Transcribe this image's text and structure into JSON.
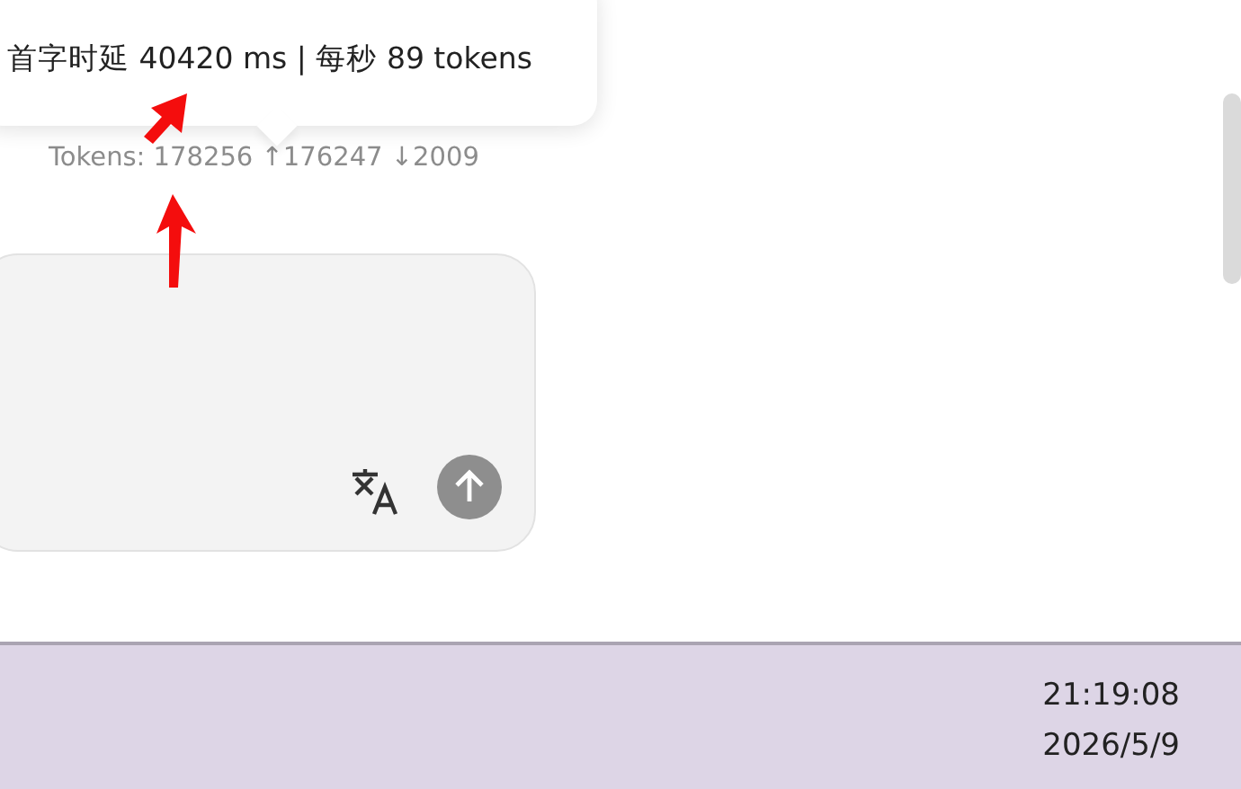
{
  "tooltip": {
    "text": "首字时延 40420 ms | 每秒 89 tokens"
  },
  "token_stats": {
    "text": "Tokens: 178256 ↑176247 ↓2009"
  },
  "composer": {
    "buttons": [
      {
        "kind": "translate"
      },
      {
        "kind": "send"
      }
    ]
  },
  "taskbar": {
    "time": "21:19:08",
    "date": "2026/5/9"
  }
}
